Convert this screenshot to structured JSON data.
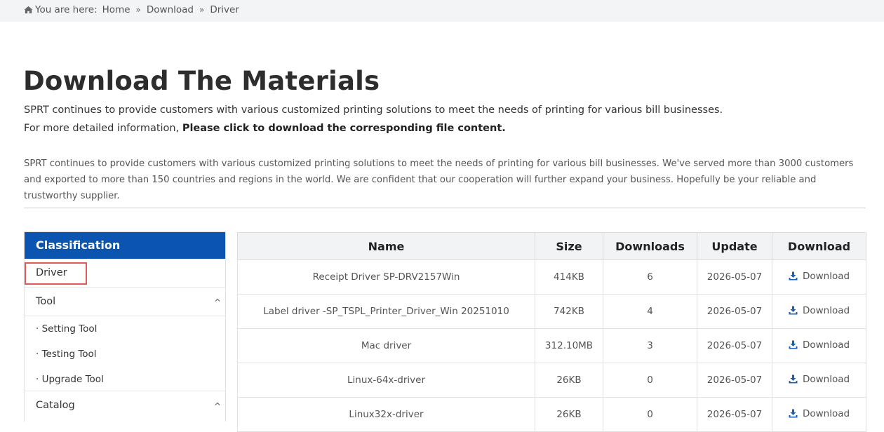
{
  "breadcrumb": {
    "prefix": "You are here:",
    "items": [
      "Home",
      "Download",
      "Driver"
    ],
    "separator": "»"
  },
  "page": {
    "title": "Download The Materials",
    "intro_line1": "SPRT continues to provide customers with various customized printing solutions to meet the needs of printing for various bill businesses.",
    "intro_line2_prefix": "For more detailed information, ",
    "intro_line2_bold": "Please click to download the corresponding file content.",
    "paragraph": "SPRT continues to provide customers with various customized printing solutions to meet the needs of printing for various bill businesses. We've served more than 3000 customers and exported to more than 150 countries and regions in the world. We are confident that our cooperation will further expand your business. Hopefully be your reliable and trustworthy supplier."
  },
  "sidebar": {
    "heading": "Classification",
    "driver": "Driver",
    "tool": "Tool",
    "tool_items": [
      "· Setting Tool",
      "· Testing Tool",
      "· Upgrade Tool"
    ],
    "catalog": "Catalog"
  },
  "table": {
    "headers": [
      "Name",
      "Size",
      "Downloads",
      "Update",
      "Download"
    ],
    "rows": [
      {
        "name": "Receipt Driver SP-DRV2157Win",
        "size": "414KB",
        "downloads": "6",
        "update": "2026-05-07",
        "action": "Download"
      },
      {
        "name": "Label driver -SP_TSPL_Printer_Driver_Win 20251010",
        "size": "742KB",
        "downloads": "4",
        "update": "2026-05-07",
        "action": "Download"
      },
      {
        "name": "Mac driver",
        "size": "312.10MB",
        "downloads": "3",
        "update": "2026-05-07",
        "action": "Download"
      },
      {
        "name": "Linux-64x-driver",
        "size": "26KB",
        "downloads": "0",
        "update": "2026-05-07",
        "action": "Download"
      },
      {
        "name": "Linux32x-driver",
        "size": "26KB",
        "downloads": "0",
        "update": "2026-05-07",
        "action": "Download"
      }
    ]
  },
  "colors": {
    "accent": "#0b55b0",
    "highlight": "#e05a5a",
    "crumb_bg": "#f3f4f6"
  },
  "icons": {
    "home": "home-icon",
    "download": "download-icon",
    "chevron": "chevron-up-icon"
  }
}
